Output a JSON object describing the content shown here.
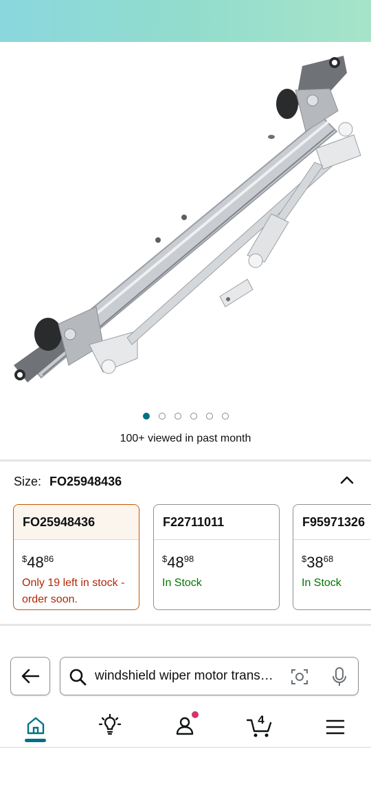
{
  "product": {
    "image_count": 6,
    "active_image_index": 0,
    "viewed_text": "100+ viewed in past month"
  },
  "size_selector": {
    "label": "Size:",
    "selected": "FO25948436",
    "options": [
      {
        "name": "FO25948436",
        "price_symbol": "$",
        "price_whole": "48",
        "price_cents": "86",
        "stock": "Only 19 left in stock - order soon.",
        "stock_status": "low",
        "selected": true
      },
      {
        "name": "F22711011",
        "price_symbol": "$",
        "price_whole": "48",
        "price_cents": "98",
        "stock": "In Stock",
        "stock_status": "in",
        "selected": false
      },
      {
        "name": "F95971326",
        "price_symbol": "$",
        "price_whole": "38",
        "price_cents": "68",
        "stock": "In Stock",
        "stock_status": "in",
        "selected": false
      }
    ]
  },
  "search": {
    "query": "windshield wiper motor transmission"
  },
  "nav": {
    "items": [
      "home-icon",
      "lightbulb-icon",
      "account-icon",
      "cart-icon",
      "menu-icon"
    ],
    "cart_count": "4",
    "active": "home"
  },
  "colors": {
    "accent": "#007185",
    "selected_border": "#c45500",
    "low_stock": "#b12704",
    "in_stock": "#007600",
    "notify_dot": "#d6336c"
  }
}
